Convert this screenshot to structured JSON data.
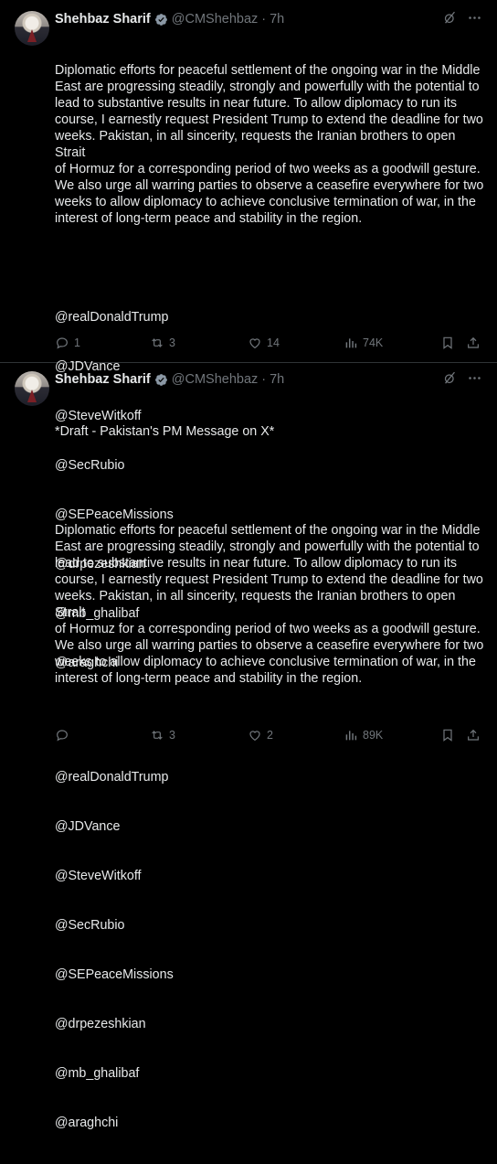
{
  "tweets": [
    {
      "author_name": "Shehbaz Sharif",
      "handle": "@CMShehbaz",
      "separator": "·",
      "time": "7h",
      "prefix": "",
      "body": "Diplomatic efforts for peaceful settlement of the ongoing war in the Middle\nEast are progressing steadily, strongly and powerfully with the potential to\nlead to substantive results in near future. To allow diplomacy to run its\ncourse, I earnestly request President Trump to extend the deadline for two\nweeks. Pakistan, in all sincerity, requests the Iranian brothers to open Strait\nof Hormuz for a corresponding period of two weeks as a goodwill gesture.\nWe also urge all warring parties to observe a ceasefire everywhere for two\nweeks to allow diplomacy to achieve conclusive termination of war, in the\ninterest of long-term peace and stability in the region.",
      "mentions": [
        "@realDonaldTrump",
        "@JDVance",
        "@SteveWitkoff",
        "@SecRubio",
        "@SEPeaceMissions",
        "@drpezeshkian",
        "@mb_ghalibaf",
        "@araghchi"
      ],
      "replies": "1",
      "reposts": "3",
      "likes": "14",
      "views": "74K"
    },
    {
      "author_name": "Shehbaz Sharif",
      "handle": "@CMShehbaz",
      "separator": "·",
      "time": "7h",
      "prefix": "*Draft - Pakistan's PM Message on X*",
      "body": "Diplomatic efforts for peaceful settlement of the ongoing war in the Middle\nEast are progressing steadily, strongly and powerfully with the potential to\nlead to substantive results in near future. To allow diplomacy to run its\ncourse, I earnestly request President Trump to extend the deadline for two\nweeks. Pakistan, in all sincerity, requests the Iranian brothers to open Strait\nof Hormuz for a corresponding period of two weeks as a goodwill gesture.\nWe also urge all warring parties to observe a ceasefire everywhere for two\nweeks to allow diplomacy to achieve conclusive termination of war, in the\ninterest of long-term peace and stability in the region.",
      "mentions": [
        "@realDonaldTrump",
        "@JDVance",
        "@SteveWitkoff",
        "@SecRubio",
        "@SEPeaceMissions",
        "@drpezeshkian",
        "@mb_ghalibaf",
        "@araghchi"
      ],
      "replies": "",
      "reposts": "3",
      "likes": "2",
      "views": "89K"
    }
  ],
  "colors": {
    "background": "#000000",
    "text": "#e7e9ea",
    "muted": "#71767b",
    "verified_badge": "#8b98a5",
    "divider": "#2f3336"
  },
  "icons": [
    "verified-badge-icon",
    "grok-icon",
    "more-icon",
    "reply-icon",
    "repost-icon",
    "like-icon",
    "views-icon",
    "bookmark-icon",
    "share-icon"
  ]
}
